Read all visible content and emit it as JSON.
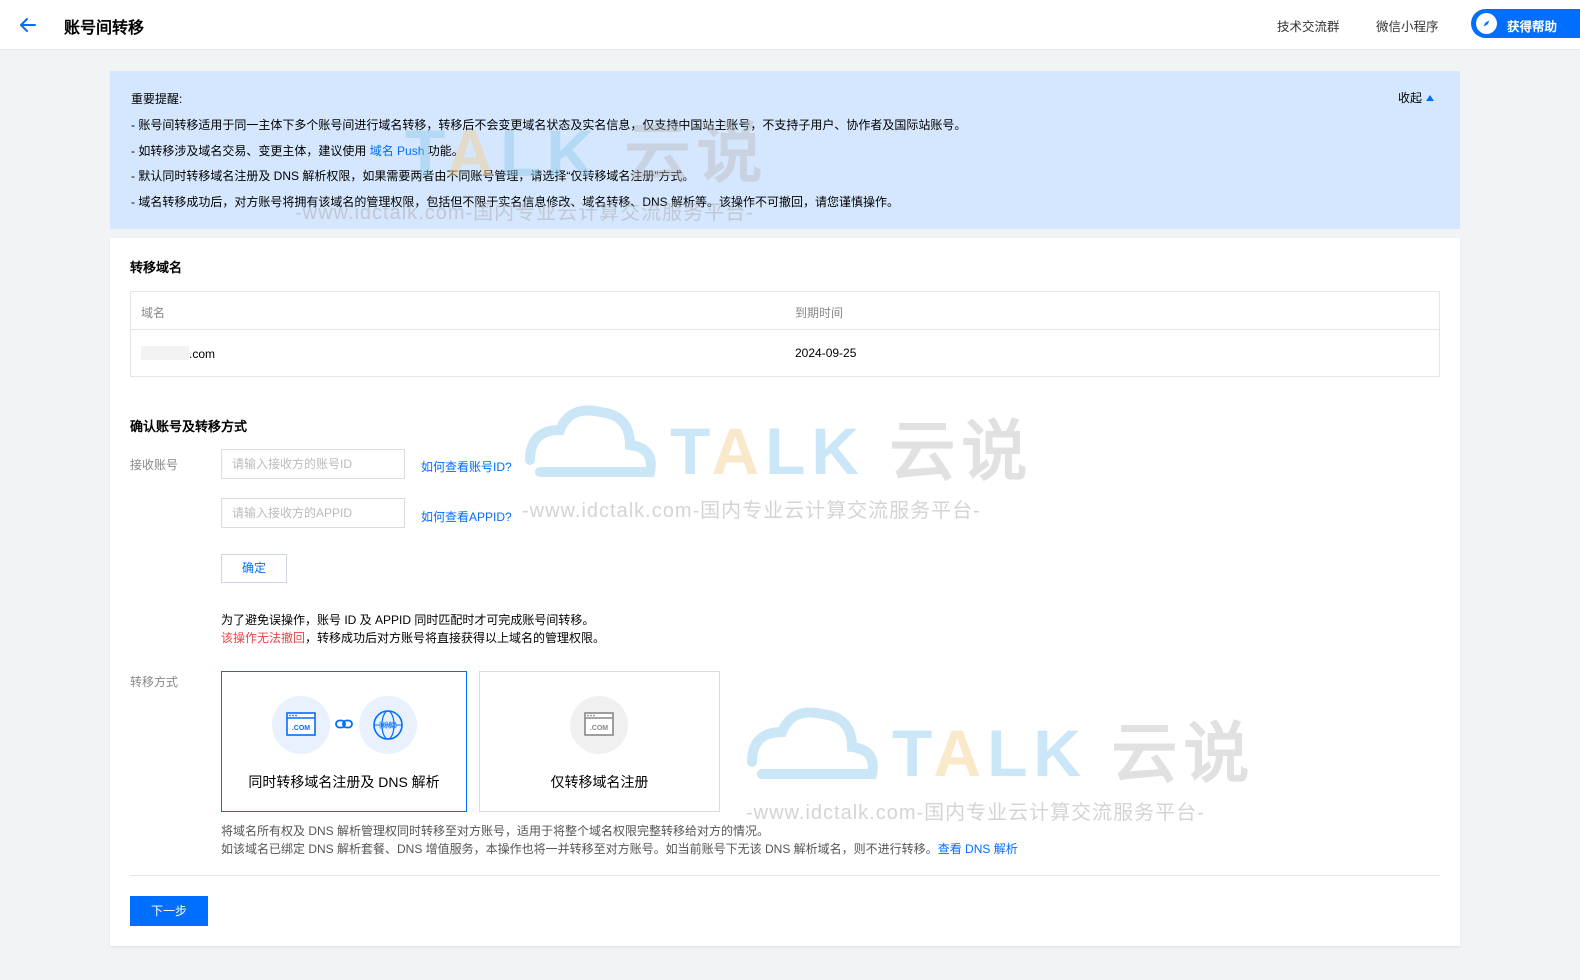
{
  "header": {
    "title": "账号间转移",
    "links": [
      "技术交流群",
      "微信小程序"
    ],
    "help_label": "获得帮助"
  },
  "notice": {
    "title": "重要提醒:",
    "collapse_label": "收起",
    "line1": "- 账号间转移适用于同一主体下多个账号间进行域名转移，转移后不会变更域名状态及实名信息，仅支持中国站主账号，不支持子用户、协作者及国际站账号。",
    "line2_prefix": "- 如转移涉及域名交易、变更主体，建议使用",
    "line2_link": "域名 Push",
    "line2_suffix": "功能。",
    "line3": "- 默认同时转移域名注册及 DNS 解析权限，如果需要两者由不同账号管理，请选择“仅转移域名注册”方式。",
    "line4": "- 域名转移成功后，对方账号将拥有该域名的管理权限，包括但不限于实名信息修改、域名转移、DNS 解析等。该操作不可撤回，请您谨慎操作。"
  },
  "domains": {
    "section_title": "转移域名",
    "columns": [
      "域名",
      "到期时间"
    ],
    "rows": [
      {
        "domain_suffix": ".com",
        "expiry": "2024-09-25"
      }
    ]
  },
  "account": {
    "section_title": "确认账号及转移方式",
    "receive_label": "接收账号",
    "account_id_placeholder": "请输入接收方的账号ID",
    "account_id_help": "如何查看账号ID?",
    "appid_placeholder": "请输入接收方的APPID",
    "appid_help": "如何查看APPID?",
    "confirm_label": "确定",
    "hint1": "为了避免误操作，账号 ID 及 APPID 同时匹配时才可完成账号间转移。",
    "hint2_warn": "该操作无法撤回",
    "hint2_rest": "，转移成功后对方账号将直接获得以上域名的管理权限。"
  },
  "method": {
    "label": "转移方式",
    "options": [
      {
        "label": "同时转移域名注册及 DNS 解析",
        "selected": true
      },
      {
        "label": "仅转移域名注册",
        "selected": false
      }
    ],
    "com_icon_text": ".COM",
    "dns_icon_text": "DNS",
    "desc1": "将域名所有权及 DNS 解析管理权同时转移至对方账号，适用于将整个域名权限完整转移给对方的情况。",
    "desc2": "如该域名已绑定 DNS 解析套餐、DNS 增值服务，本操作也将一并转移至对方账号。如当前账号下无该 DNS 解析域名，则不进行转移。",
    "desc2_link": "查看 DNS 解析"
  },
  "footer": {
    "next_label": "下一步"
  },
  "watermark": {
    "brand_a": "T",
    "brand_b": "A",
    "brand_c": "LK",
    "brand_cn": "云说",
    "tagline": "-www.idctalk.com-国内专业云计算交流服务平台-"
  },
  "colors": {
    "accent": "#006eff",
    "notice_bg": "#d5e7fe",
    "warning": "#e54545"
  }
}
